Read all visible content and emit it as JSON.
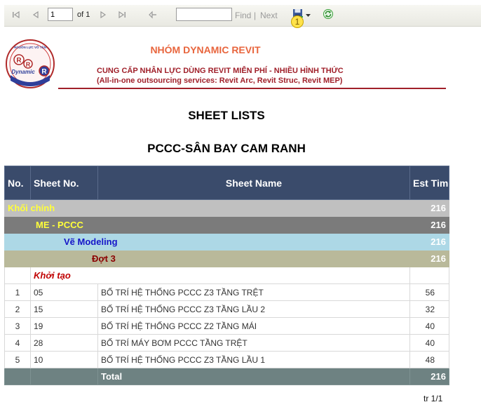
{
  "toolbar": {
    "page_value": "1",
    "of_text": "of 1",
    "find_label": "Find",
    "separator": "|",
    "next_label": "Next",
    "badge_number": "1",
    "icons": [
      "first-page-icon",
      "previous-page-icon",
      "next-page-icon",
      "last-page-icon",
      "back-icon",
      "export-save-icon",
      "dropdown-arrow-icon",
      "refresh-icon"
    ]
  },
  "header": {
    "logo_top_text": "NGUỒN LỰC VÔ TẬN",
    "logo_mid_text": "Dynamic",
    "logo_letter": "R",
    "company": "NHÓM DYNAMIC REVIT",
    "tagline1": "CUNG CẤP NHÂN LỰC DÙNG REVIT MIỄN PHÍ - NHIỀU HÌNH THỨC",
    "tagline2": "(All-in-one outsourcing services: Revit Arc, Revit Struc, Revit MEP)"
  },
  "report": {
    "title": "SHEET LISTS",
    "project": "PCCC-SÂN BAY CAM RANH"
  },
  "table": {
    "headers": {
      "no": "No.",
      "sheet_no": "Sheet No.",
      "sheet_name": "Sheet Name",
      "est_time": "Est Time"
    },
    "groups": [
      {
        "label": "Khối chính",
        "total": "216"
      },
      {
        "label": "ME - PCCC",
        "total": "216"
      },
      {
        "label": "Vẽ Modeling",
        "total": "216"
      },
      {
        "label": "Đợt 3",
        "total": "216"
      }
    ],
    "subgroup": "Khởi tạo",
    "rows": [
      {
        "no": "1",
        "sheet_no": "05",
        "name": "BỐ TRÍ HỆ THỐNG PCCC Z3 TẦNG TRỆT",
        "time": "56"
      },
      {
        "no": "2",
        "sheet_no": "15",
        "name": "BỐ TRÍ HỆ  THỐNG PCCC Z3 TẦNG LẦU 2",
        "time": "32"
      },
      {
        "no": "3",
        "sheet_no": "19",
        "name": "BỐ TRÍ HỆ  THỐNG PCCC Z2 TẦNG MÁI",
        "time": "40"
      },
      {
        "no": "4",
        "sheet_no": "28",
        "name": "BỐ TRÍ MÁY BƠM PCCC TẦNG TRỆT",
        "time": "40"
      },
      {
        "no": "5",
        "sheet_no": "10",
        "name": "BỐ TRÍ HỆ  THỐNG PCCC Z3 TẦNG LẦU 1",
        "time": "48"
      }
    ],
    "total_label": "Total",
    "total_value": "216"
  },
  "footer": {
    "page_indicator": "tr 1/1"
  },
  "colors": {
    "header_bg": "#3a4b6b",
    "group1_bg": "#c0c0c0",
    "group2_bg": "#7b7b7b",
    "group3_bg": "#add8e6",
    "group4_bg": "#b9b99a",
    "total_bg": "#6e8282",
    "brand_orange": "#e8653d",
    "brand_red": "#a0202a"
  }
}
